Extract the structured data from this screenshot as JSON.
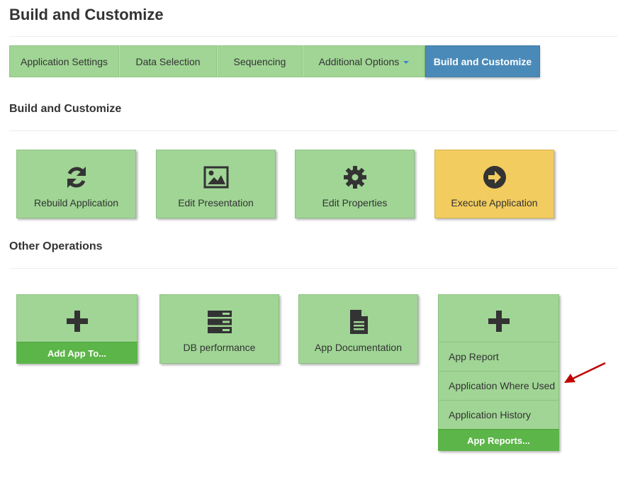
{
  "page": {
    "title": "Build and Customize"
  },
  "tabs": [
    {
      "label": "Application Settings"
    },
    {
      "label": "Data Selection"
    },
    {
      "label": "Sequencing"
    },
    {
      "label": "Additional Options"
    },
    {
      "label": "Build and Customize",
      "active": true
    }
  ],
  "build_section": {
    "title": "Build and Customize",
    "tiles": [
      {
        "label": "Rebuild Application",
        "icon": "refresh-icon"
      },
      {
        "label": "Edit Presentation",
        "icon": "image-icon"
      },
      {
        "label": "Edit Properties",
        "icon": "gear-icon"
      },
      {
        "label": "Execute Application",
        "icon": "arrow-circle-right-icon"
      }
    ]
  },
  "other_section": {
    "title": "Other Operations",
    "add_app": {
      "icon": "plus-icon",
      "footer": "Add App To..."
    },
    "db_performance": {
      "label": "DB performance",
      "icon": "server-icon"
    },
    "app_documentation": {
      "label": "App Documentation",
      "icon": "document-icon"
    },
    "app_reports": {
      "icon": "plus-icon",
      "items": [
        "App Report",
        "Application Where Used",
        "Application History"
      ],
      "footer": "App Reports..."
    }
  },
  "colors": {
    "tile_green": "#a0d595",
    "footer_green": "#5cb548",
    "active_tab": "#4a8ab8",
    "execute_yellow": "#f2cc5e",
    "arrow_red": "#c00000"
  }
}
